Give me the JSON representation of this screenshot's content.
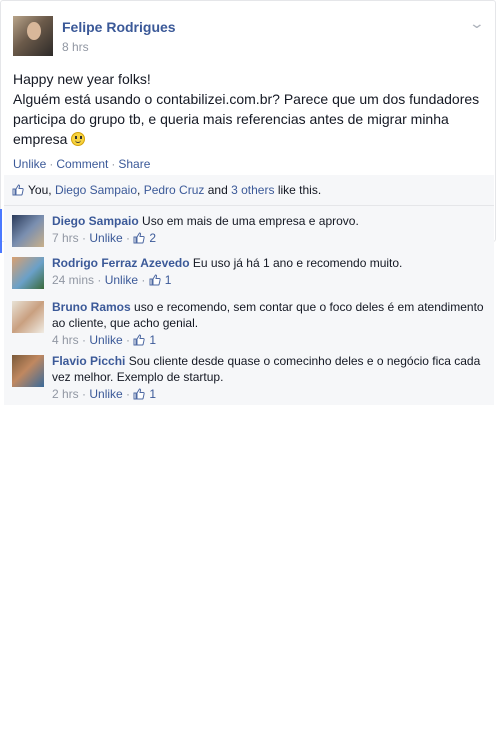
{
  "post": {
    "author": "Felipe Rodrigues",
    "time": "8 hrs",
    "line1": "Happy new year folks!",
    "line2": "Alguém está usando o contabilizei.com.br? Parece que um dos fundadores participa do grupo tb, e queria mais referencias antes de migrar minha empresa",
    "actions": {
      "unlike": "Unlike",
      "comment": "Comment",
      "share": "Share",
      "sep": "·"
    }
  },
  "likes": {
    "you": "You,",
    "name1": "Diego Sampaio",
    "comma": ",",
    "name2": "Pedro Cruz",
    "and": "and",
    "others": "3 others",
    "suffix": "like this."
  },
  "comments": [
    {
      "name": "Diego Sampaio",
      "text": "Uso em mais de uma empresa e aprovo.",
      "time": "7 hrs",
      "unlike": "Unlike",
      "count": "2"
    },
    {
      "name": "Rodrigo Ferraz Azevedo",
      "text": "Eu uso já há 1 ano e recomendo muito.",
      "time": "24 mins",
      "unlike": "Unlike",
      "count": "1"
    },
    {
      "name": "Bruno Ramos",
      "text": "uso e recomendo, sem contar que o foco deles é em atendimento ao cliente, que acho genial.",
      "time": "4 hrs",
      "unlike": "Unlike",
      "count": "1"
    },
    {
      "name": "Flavio Picchi",
      "text": "Sou cliente desde quase o comecinho deles e o negócio fica cada vez melhor. Exemplo de startup.",
      "time": "2 hrs",
      "unlike": "Unlike",
      "count": "1"
    }
  ],
  "icons": {
    "thumbs_up": "thumbs-up-icon",
    "chevron": "chevron-down-icon",
    "smiley": "smiley-emoji-icon"
  },
  "colors": {
    "link": "#3b5998",
    "meta": "#9197a3",
    "ufi_bg": "#f6f7f9"
  }
}
